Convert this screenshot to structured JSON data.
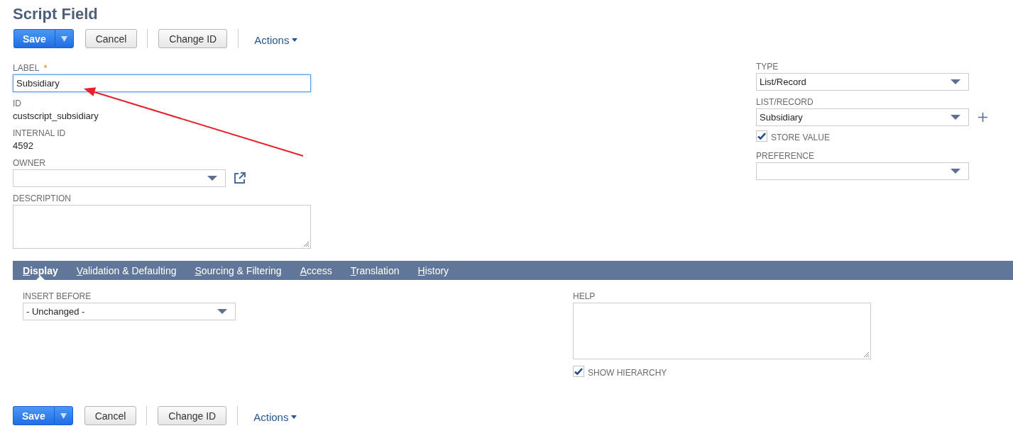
{
  "title": "Script Field",
  "top_toolbar": {
    "save": "Save",
    "cancel": "Cancel",
    "change_id": "Change ID",
    "actions": "Actions"
  },
  "form": {
    "left": [
      {
        "kind": "text-input",
        "label": "LABEL",
        "required_mark": "*",
        "value": "Subsidiary",
        "focused": true
      },
      {
        "kind": "readonly",
        "label": "ID",
        "value": "custscript_subsidiary"
      },
      {
        "kind": "readonly",
        "label": "INTERNAL ID",
        "value": "4592"
      },
      {
        "kind": "select",
        "label": "OWNER",
        "open_link": true
      },
      {
        "kind": "textarea",
        "label": "DESCRIPTION"
      }
    ],
    "right": [
      {
        "kind": "select",
        "label": "TYPE",
        "value": "List/Record"
      },
      {
        "kind": "select",
        "label": "LIST/RECORD",
        "value": "Subsidiary",
        "add_button": true
      },
      {
        "kind": "checkbox",
        "label": "STORE VALUE",
        "checked": true
      },
      {
        "kind": "select",
        "label": "PREFERENCE"
      }
    ]
  },
  "tabs": [
    {
      "label": "Display",
      "selected": true
    },
    {
      "label": "Validation & Defaulting",
      "selected": false
    },
    {
      "label": "Sourcing & Filtering",
      "selected": false
    },
    {
      "label": "Access",
      "selected": false
    },
    {
      "label": "Translation",
      "selected": false
    },
    {
      "label": "History",
      "selected": false
    }
  ],
  "tab_panel": {
    "left": [
      {
        "kind": "select",
        "label": "INSERT BEFORE",
        "value": "- Unchanged -"
      }
    ],
    "right": [
      {
        "kind": "textarea",
        "label": "HELP"
      },
      {
        "kind": "checkbox",
        "label": "SHOW HIERARCHY",
        "checked": true
      }
    ]
  },
  "bottom_toolbar": {
    "save": "Save",
    "cancel": "Cancel",
    "change_id": "Change ID",
    "actions": "Actions"
  }
}
